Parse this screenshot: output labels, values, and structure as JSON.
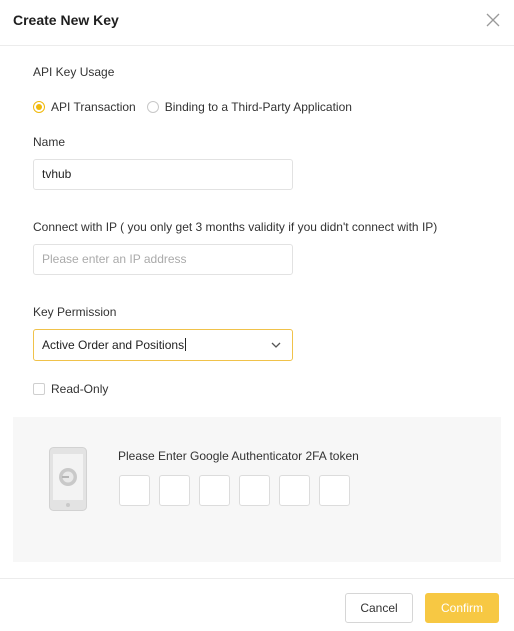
{
  "dialog": {
    "title": "Create New Key"
  },
  "usage": {
    "label": "API Key Usage",
    "options": [
      {
        "label": "API Transaction",
        "selected": true
      },
      {
        "label": "Binding to a Third-Party Application",
        "selected": false
      }
    ]
  },
  "name": {
    "label": "Name",
    "value": "tvhub"
  },
  "ip": {
    "label": "Connect with IP ( you only get 3 months validity if you didn't connect with IP)",
    "placeholder": "Please enter an IP address",
    "value": ""
  },
  "permission": {
    "label": "Key Permission",
    "selected": "Active Order and Positions"
  },
  "readonly": {
    "label": "Read-Only",
    "checked": false
  },
  "twofa": {
    "title": "Please Enter Google Authenticator 2FA token",
    "digits": [
      "",
      "",
      "",
      "",
      "",
      ""
    ]
  },
  "footer": {
    "cancel_label": "Cancel",
    "confirm_label": "Confirm"
  },
  "colors": {
    "accent": "#f0b90b",
    "confirm_bg": "#f7c843",
    "panel_bg": "#f7f7f7"
  }
}
